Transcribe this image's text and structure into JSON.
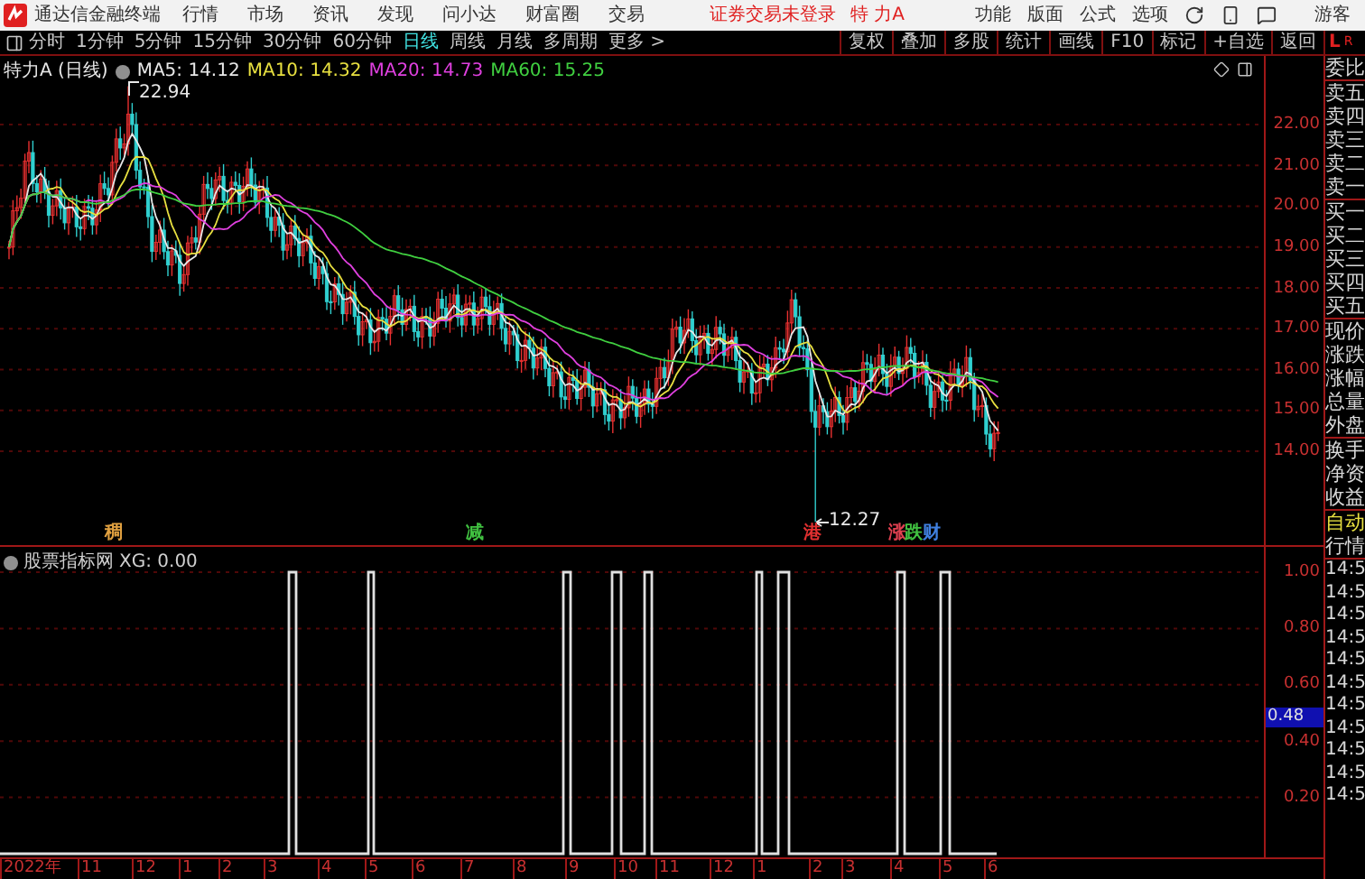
{
  "app_bar": {
    "title": "通达信金融终端",
    "menus": [
      "行情",
      "市场",
      "资讯",
      "发现",
      "问小达",
      "财富圈",
      "交易"
    ],
    "login_status": "证券交易未登录",
    "stock": "特 力A",
    "right_menus": [
      "功能",
      "版面",
      "公式",
      "选项"
    ],
    "user": "游客"
  },
  "toolbar": {
    "periods": [
      {
        "label": "分时",
        "selected": false
      },
      {
        "label": "1分钟",
        "selected": false
      },
      {
        "label": "5分钟",
        "selected": false
      },
      {
        "label": "15分钟",
        "selected": false
      },
      {
        "label": "30分钟",
        "selected": false
      },
      {
        "label": "60分钟",
        "selected": false
      },
      {
        "label": "日线",
        "selected": true
      },
      {
        "label": "周线",
        "selected": false
      },
      {
        "label": "月线",
        "selected": false
      },
      {
        "label": "多周期",
        "selected": false
      },
      {
        "label": "更多 >",
        "selected": false
      }
    ],
    "tools": [
      "复权",
      "叠加",
      "多股",
      "统计",
      "画线",
      "F10",
      "标记",
      "+自选",
      "返回"
    ]
  },
  "chart": {
    "title": "特力A (日线)",
    "ma": [
      {
        "label": "MA5: 14.12",
        "color": "#e8e8e8"
      },
      {
        "label": "MA10: 14.32",
        "color": "#e8e040"
      },
      {
        "label": "MA20: 14.73",
        "color": "#e040e0"
      },
      {
        "label": "MA60: 15.25",
        "color": "#40d040"
      }
    ],
    "high_label": "22.94",
    "low_label": "12.27",
    "price_axis": [
      "22.00",
      "21.00",
      "20.00",
      "19.00",
      "18.00",
      "17.00",
      "16.00",
      "15.00",
      "14.00"
    ],
    "events": [
      {
        "label": "稠",
        "color": "#e0a040"
      },
      {
        "label": "减",
        "color": "#40c040"
      },
      {
        "label": "港",
        "color": "#e03030"
      },
      {
        "label": "涨",
        "color": "#e04050"
      },
      {
        "label": "跌",
        "color": "#40c040"
      },
      {
        "label": "财",
        "color": "#4080e0"
      }
    ]
  },
  "indicator": {
    "title": "股票指标网",
    "value": "XG: 0.00",
    "axis": [
      "1.00",
      "0.80",
      "0.60",
      "0.40",
      "0.20"
    ],
    "cursor_value": "0.48"
  },
  "time_axis": [
    "2022年",
    "11",
    "12",
    "1",
    "2",
    "3",
    "4",
    "5",
    "6",
    "7",
    "8",
    "9",
    "10",
    "11",
    "12",
    "1",
    "2",
    "3",
    "4",
    "5",
    "6"
  ],
  "quote_panel": {
    "corner": "L",
    "corner_small": "R",
    "groups": [
      [
        "委比"
      ],
      [
        "卖五",
        "卖四",
        "卖三",
        "卖二",
        "卖一"
      ],
      [
        "买一",
        "买二",
        "买三",
        "买四",
        "买五"
      ],
      [
        "现价",
        "涨跌",
        "涨幅",
        "总量",
        "外盘"
      ],
      [
        "换手",
        "净资",
        "收益"
      ]
    ],
    "mode": "自动",
    "tab": "行情",
    "times": [
      "14:5",
      "14:5",
      "14:5",
      "14:5",
      "14:5",
      "14:5",
      "14:5",
      "14:5",
      "14:5",
      "14:5",
      "14:5"
    ]
  }
}
